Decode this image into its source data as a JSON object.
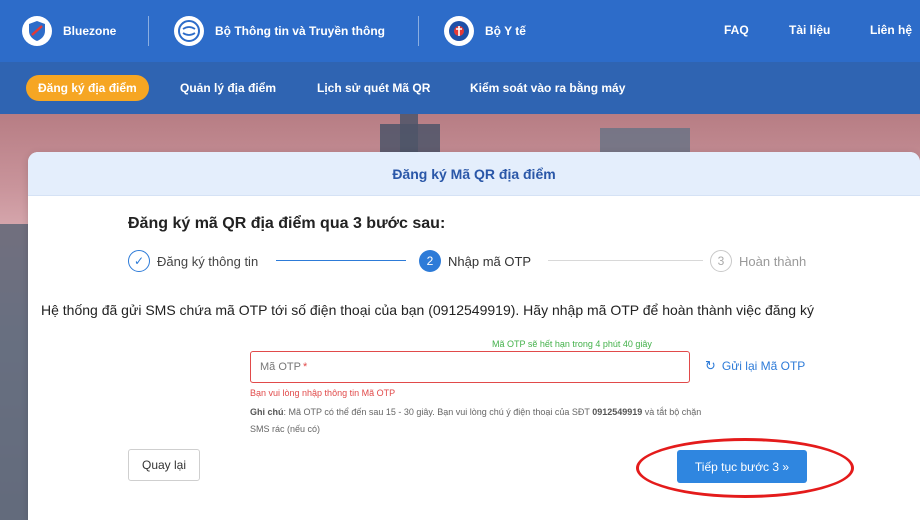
{
  "topbar": {
    "brands": [
      {
        "label": "Bluezone",
        "icon": "bluezone-shield-icon"
      },
      {
        "label": "Bộ Thông tin và Truyền thông",
        "icon": "ministry-ic-logo-icon"
      },
      {
        "label": "Bộ Y tế",
        "icon": "ministry-health-logo-icon"
      }
    ],
    "links": [
      "FAQ",
      "Tài liệu",
      "Liên hệ"
    ]
  },
  "subnav": {
    "items": [
      "Đăng ký địa điểm",
      "Quản lý địa điểm",
      "Lịch sử quét Mã QR",
      "Kiểm soát vào ra bằng máy"
    ],
    "active_index": 0
  },
  "card": {
    "title": "Đăng ký Mã QR địa điểm",
    "intro": "Đăng ký mã QR địa điểm qua 3 bước sau:",
    "steps": [
      {
        "marker": "✓",
        "label": "Đăng ký thông tin",
        "state": "done"
      },
      {
        "marker": "2",
        "label": "Nhập mã OTP",
        "state": "active"
      },
      {
        "marker": "3",
        "label": "Hoàn thành",
        "state": "todo"
      }
    ],
    "message": "Hệ thống đã gửi SMS chứa mã OTP tới số điện thoại của bạn (0912549919). Hãy nhập mã OTP để hoàn thành việc đăng ký",
    "otp": {
      "expire_text": "Mã OTP sẽ hết hạn trong 4 phút 40 giây",
      "placeholder": "Mã OTP",
      "required_mark": "*",
      "error": "Bạn vui lòng nhập thông tin Mã OTP",
      "resend_label": "Gửi lại Mã OTP",
      "note_label": "Ghi chú",
      "note_text_1": ": Mã OTP có thể đến sau 15 - 30 giây. Bạn vui lòng chú ý điện thoại của SĐT ",
      "note_phone": "0912549919",
      "note_text_2": " và tắt bộ chặn SMS rác (nếu có)"
    },
    "back_label": "Quay lại",
    "next_label": "Tiếp tục bước 3 »"
  },
  "colors": {
    "primary_blue": "#2d6cc9",
    "accent_orange": "#f6a623",
    "button_blue": "#2f86e0",
    "error_red": "#e14a4a",
    "success_green": "#43b14a",
    "highlight_red": "#e41b1b"
  }
}
